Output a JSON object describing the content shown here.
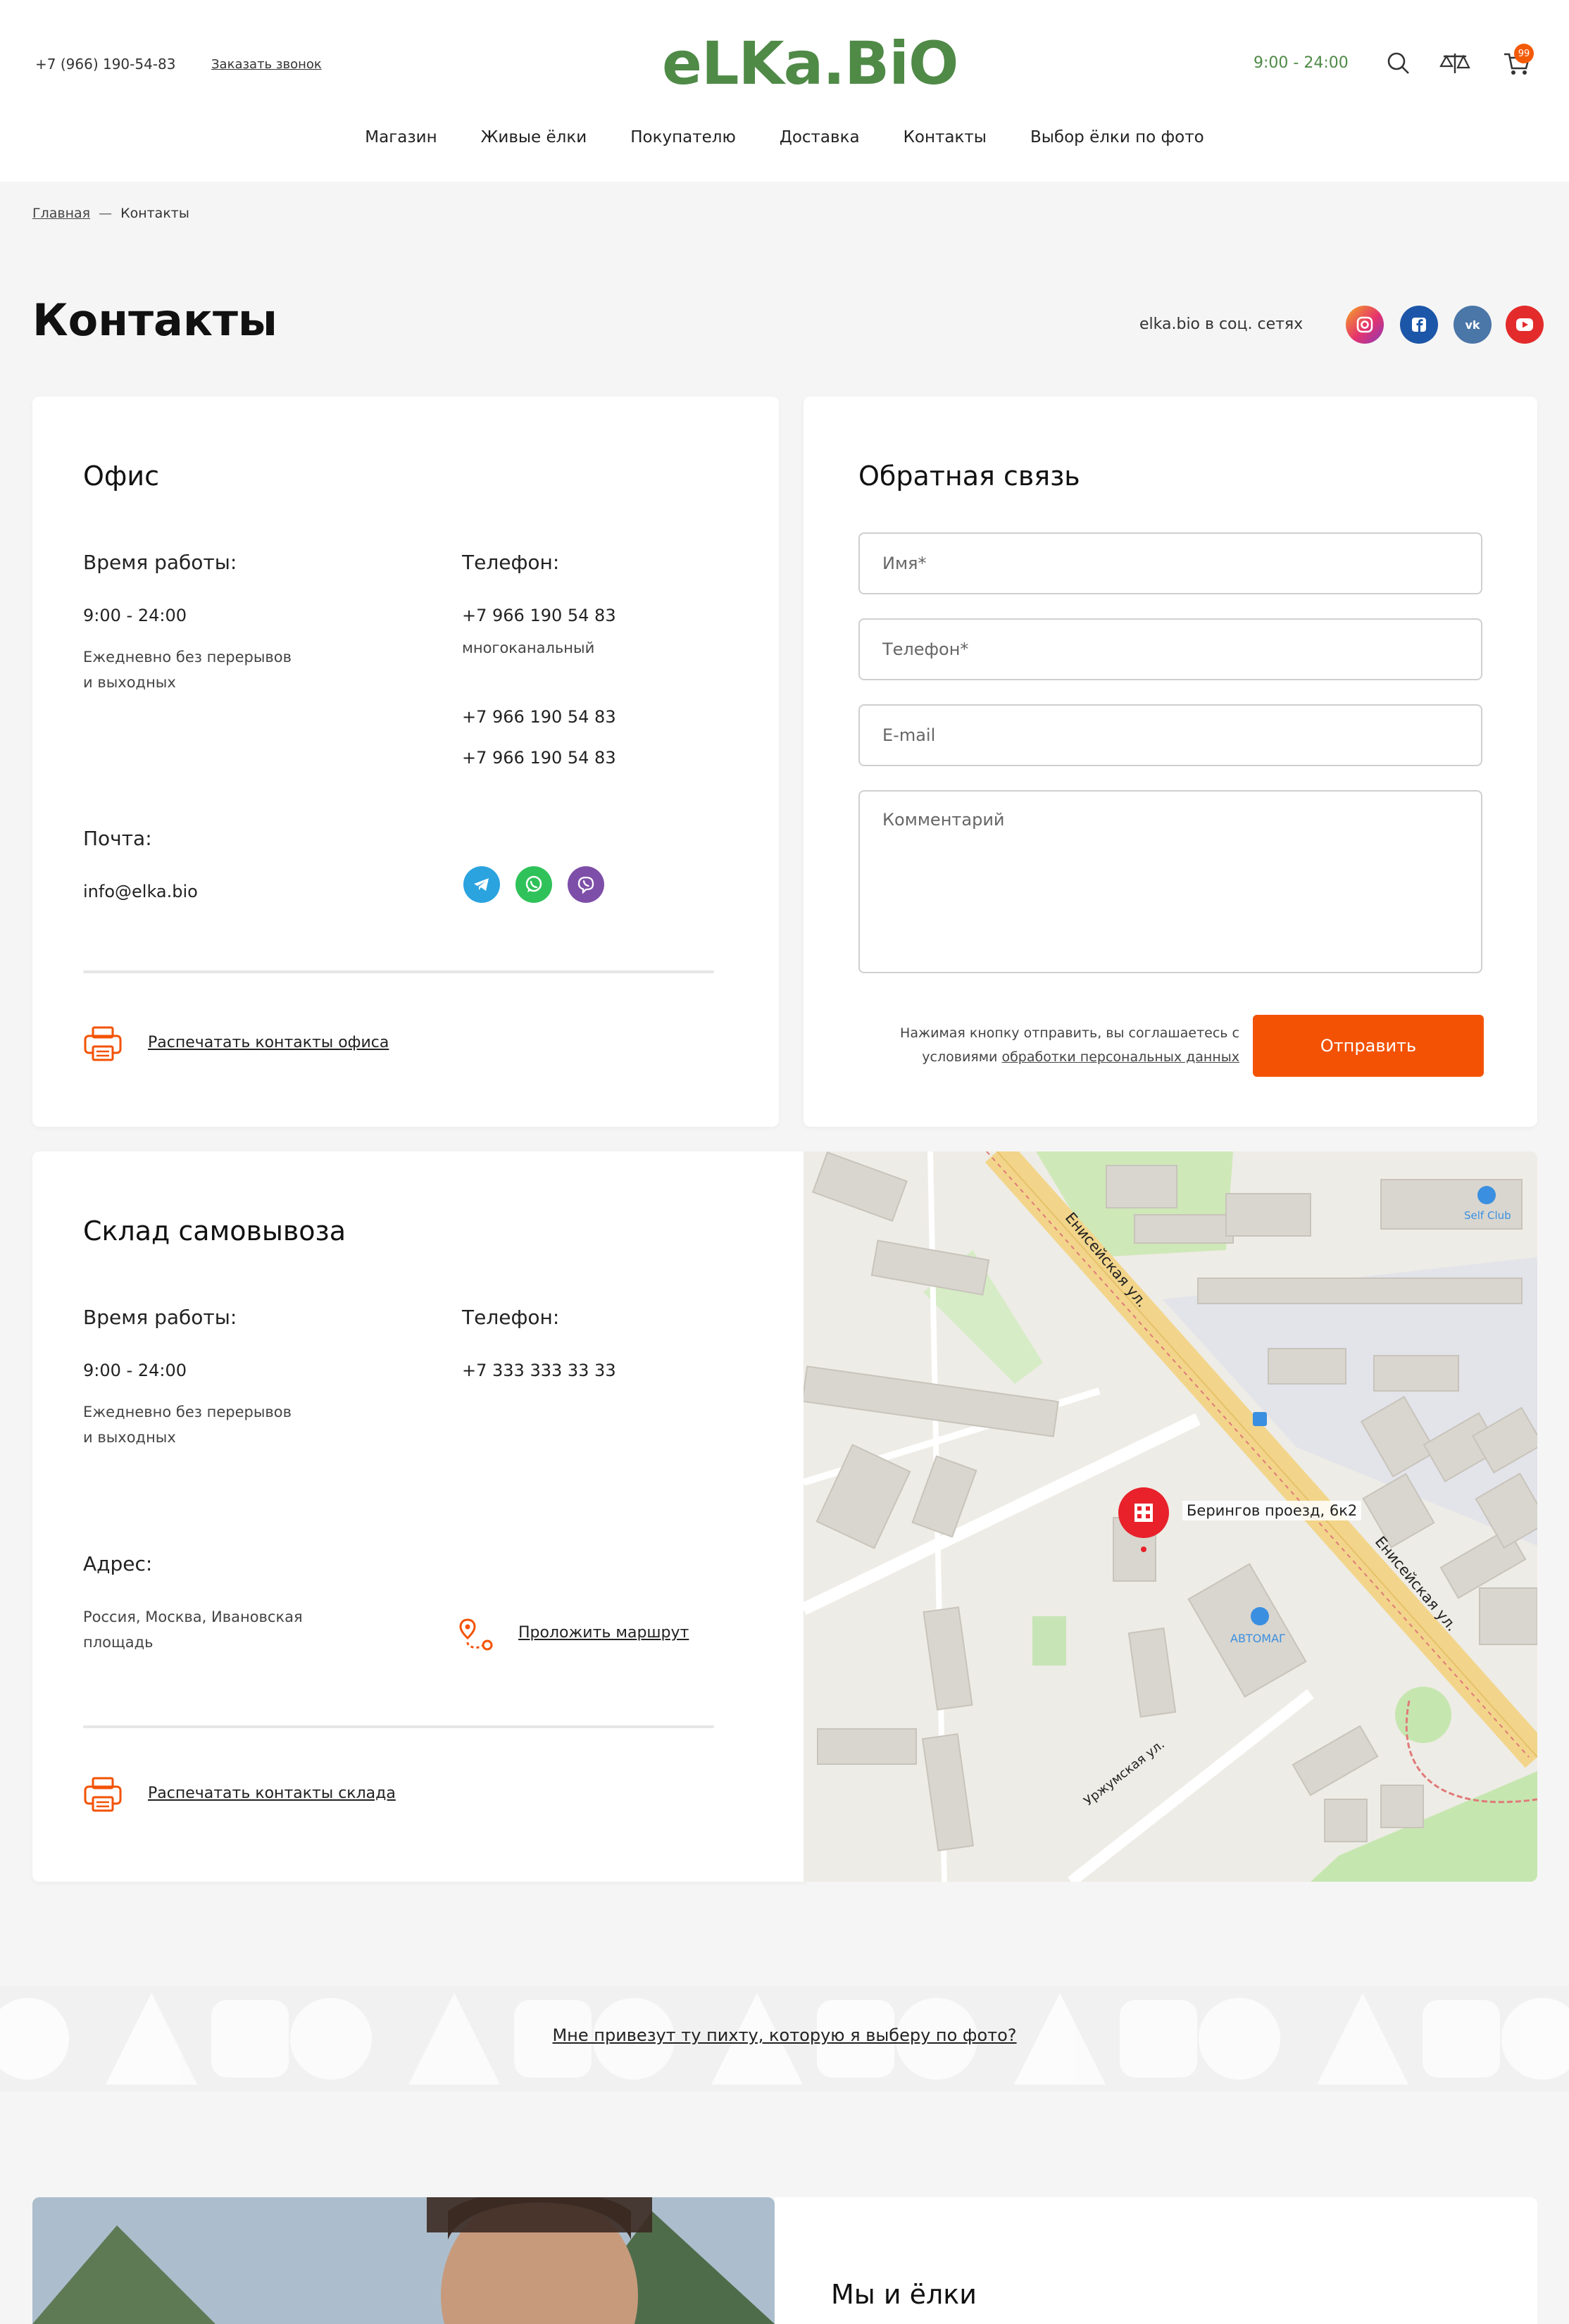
{
  "header": {
    "phone": "+7 (966) 190-54-83",
    "callback": "Заказать звонок",
    "logo": "eLKa.BiO",
    "hours": "9:00 - 24:00",
    "cart_count": "99",
    "icons": [
      "search-icon",
      "compare-icon",
      "cart-icon"
    ]
  },
  "nav": {
    "items": [
      "Магазин",
      "Живые ёлки",
      "Покупателю",
      "Доставка",
      "Контакты",
      "Выбор ёлки по фото"
    ]
  },
  "breadcrumb": {
    "home": "Главная",
    "sep": "—",
    "current": "Контакты"
  },
  "page": {
    "title": "Контакты",
    "social_label": "elka.bio в соц. сетях"
  },
  "social": [
    {
      "icon": "instagram-icon",
      "color": "#e5336d"
    },
    {
      "icon": "facebook-icon",
      "color": "#1c56a8"
    },
    {
      "icon": "vk-icon",
      "color": "#4a76a8"
    },
    {
      "icon": "youtube-icon",
      "color": "#e32b2b"
    }
  ],
  "office": {
    "title": "Офис",
    "hours_label": "Время работы:",
    "hours": "9:00 - 24:00",
    "hours_note_1": "Ежедневно без перерывов",
    "hours_note_2": "и выходных",
    "phone_label": "Телефон:",
    "phone_1": "+7 966 190 54 83",
    "phone_1_note": "многоканальный",
    "phone_2": "+7 966 190 54 83",
    "phone_3": "+7 966 190 54 83",
    "mail_label": "Почта:",
    "mail": "info@elka.bio",
    "messengers": [
      {
        "icon": "telegram-icon",
        "color": "#2aa3df"
      },
      {
        "icon": "whatsapp-icon",
        "color": "#30c25a"
      },
      {
        "icon": "viber-icon",
        "color": "#7e4fa8"
      }
    ],
    "print": "Распечатать контакты офиса"
  },
  "feedback": {
    "title": "Обратная связь",
    "name_placeholder": "Имя*",
    "phone_placeholder": "Телефон*",
    "email_placeholder": "E-mail",
    "comment_placeholder": "Комментарий",
    "agree_text": "Нажимая кнопку отправить, вы соглашаетесь с условиями",
    "agree_link": "обработки персональных данных",
    "submit": "Отправить"
  },
  "warehouse": {
    "title": "Склад самовывоза",
    "hours_label": "Время работы:",
    "hours": "9:00 - 24:00",
    "hours_note_1": "Ежедневно без перерывов",
    "hours_note_2": "и выходных",
    "phone_label": "Телефон:",
    "phone": "+7 333 333 33 33",
    "address_label": "Адрес:",
    "address_1": "Россия, Москва, Ивановская",
    "address_2": "площадь",
    "route": "Проложить маршрут",
    "print": "Распечатать контакты склада"
  },
  "map": {
    "pin_label": "Берингов проезд, 6к2",
    "street_1": "Енисейская ул.",
    "street_2": "Енисейская ул.",
    "street_3": "Уржумская ул.",
    "poi": "АВТОМАГ",
    "poi_2": "Self Club"
  },
  "promo": {
    "link": "Мне привезут ту пихту, которую я выберу по фото?"
  },
  "about": {
    "title": "Мы и ёлки"
  }
}
